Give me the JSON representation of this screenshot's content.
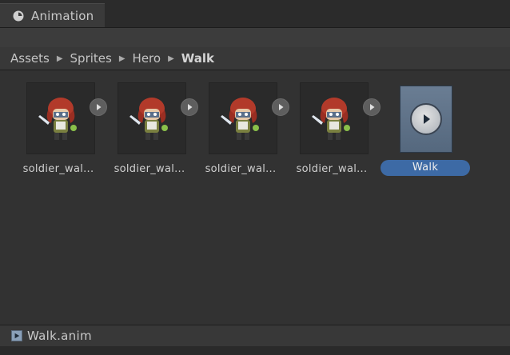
{
  "tab": {
    "title": "Animation",
    "icon": "clock-icon"
  },
  "breadcrumb": [
    "Assets",
    "Sprites",
    "Hero",
    "Walk"
  ],
  "assets": [
    {
      "label": "soldier_wal...",
      "icon": "soldier-sprite"
    },
    {
      "label": "soldier_wal...",
      "icon": "soldier-sprite"
    },
    {
      "label": "soldier_wal...",
      "icon": "soldier-sprite"
    },
    {
      "label": "soldier_wal...",
      "icon": "soldier-sprite"
    }
  ],
  "clip": {
    "label": "Walk",
    "icon": "play-icon",
    "accent": "#3d6aa5"
  },
  "status": {
    "file": "Walk.anim",
    "icon": "animation-file-icon"
  }
}
